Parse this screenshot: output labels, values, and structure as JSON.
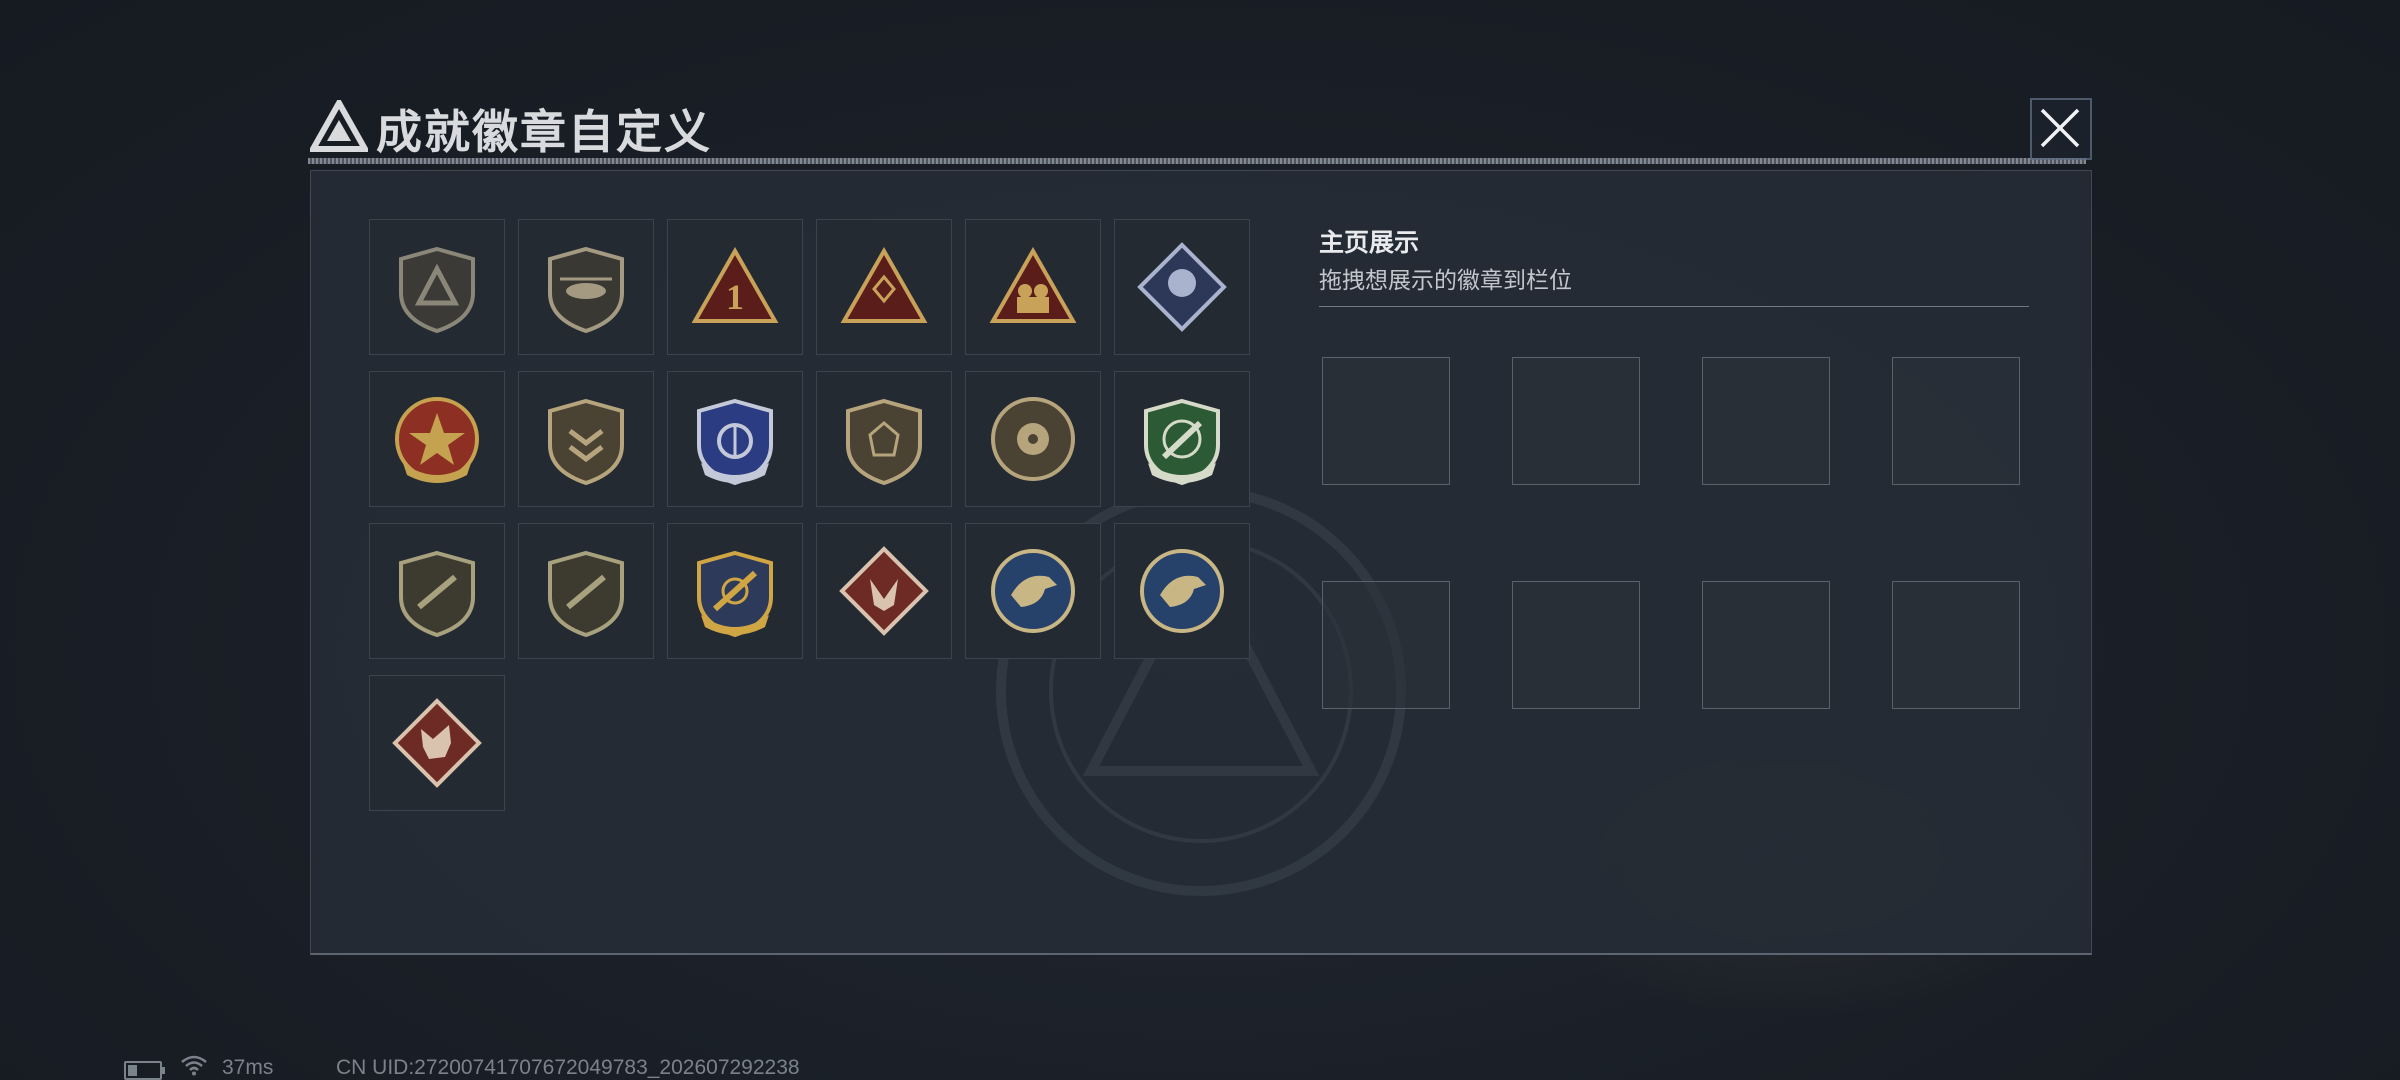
{
  "header": {
    "title": "成就徽章自定义",
    "logo_icon": "triangle-logo-icon",
    "close_icon": "close-icon"
  },
  "badges": [
    {
      "name": "triangle-shield-badge",
      "colors": [
        "#8a8779",
        "#3b3a37"
      ]
    },
    {
      "name": "helicopter-badge",
      "colors": [
        "#a49a82",
        "#3a3833"
      ]
    },
    {
      "name": "number-one-triangle-badge",
      "colors": [
        "#c9a25a",
        "#5a1d1a"
      ]
    },
    {
      "name": "gem-hands-triangle-badge",
      "colors": [
        "#c9a25a",
        "#5a1d1a"
      ]
    },
    {
      "name": "soldiers-triangle-badge",
      "colors": [
        "#c9a25a",
        "#5a1d1a"
      ]
    },
    {
      "name": "fist-diamond-badge",
      "colors": [
        "#a9b3cd",
        "#2d3758"
      ]
    },
    {
      "name": "star-wheel-badge",
      "colors": [
        "#c5a24f",
        "#8e2f24"
      ]
    },
    {
      "name": "chevron-shield-badge",
      "colors": [
        "#b5a47c",
        "#4a4233"
      ]
    },
    {
      "name": "blue-stars-shield-badge",
      "colors": [
        "#c3c9d8",
        "#2c3c82"
      ]
    },
    {
      "name": "gem-shield-badge",
      "colors": [
        "#b5a47c",
        "#4a4233"
      ]
    },
    {
      "name": "crosshair-skull-badge",
      "colors": [
        "#b5a47c",
        "#4a4233"
      ]
    },
    {
      "name": "green-rifle-shield-badge",
      "colors": [
        "#d5dbc8",
        "#2b5a35"
      ]
    },
    {
      "name": "rifle-shield-badge-1",
      "colors": [
        "#a8a17e",
        "#3d3b30"
      ]
    },
    {
      "name": "rifle-shield-badge-2",
      "colors": [
        "#a8a17e",
        "#3d3b30"
      ]
    },
    {
      "name": "winged-rifle-shield-badge",
      "colors": [
        "#d0a544",
        "#2e3a5a"
      ]
    },
    {
      "name": "wolf-diamond-badge",
      "colors": [
        "#d9c2ae",
        "#6e2a25"
      ]
    },
    {
      "name": "eagle-round-badge-1",
      "colors": [
        "#c9b685",
        "#26416a"
      ]
    },
    {
      "name": "eagle-round-badge-2",
      "colors": [
        "#c9b685",
        "#26416a"
      ]
    },
    {
      "name": "dragon-diamond-badge",
      "colors": [
        "#d9c2ae",
        "#6e2a25"
      ]
    }
  ],
  "showcase": {
    "title": "主页展示",
    "subtitle": "拖拽想展示的徽章到栏位",
    "slots": 8
  },
  "status_bar": {
    "ping": "37ms",
    "uid": "CN UID:272007417076720497­83_202607292238"
  }
}
